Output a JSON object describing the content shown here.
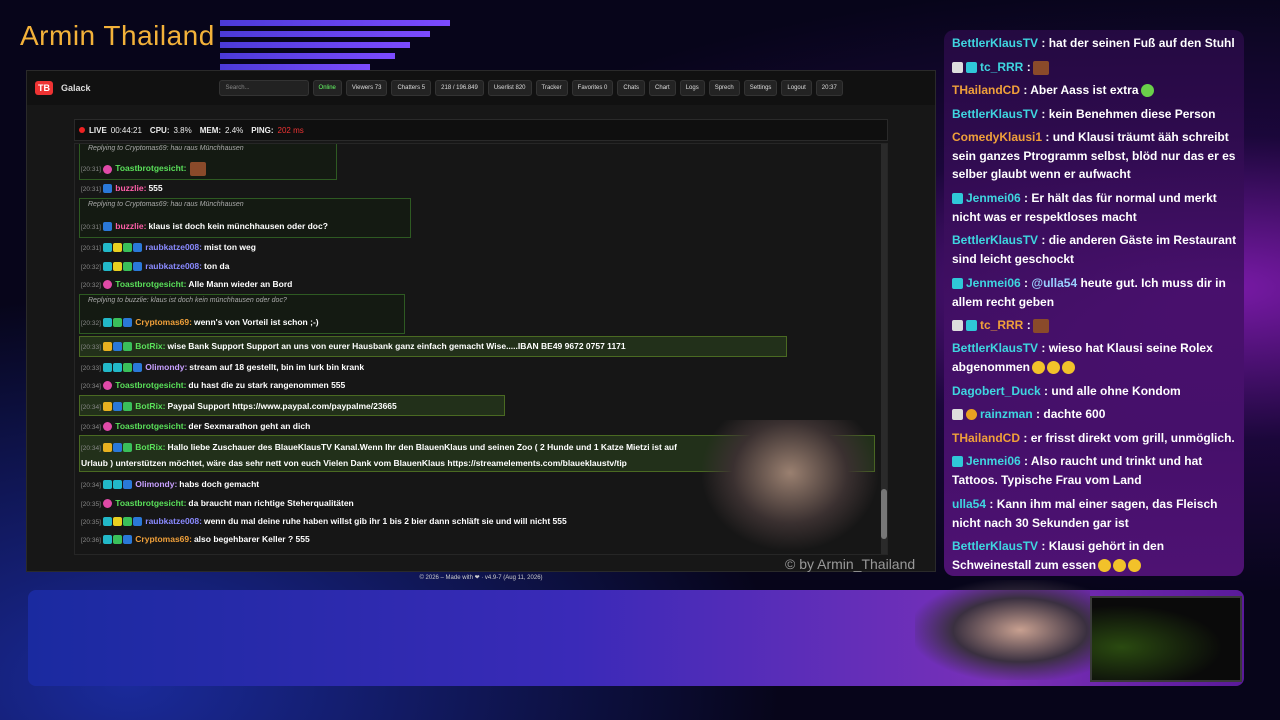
{
  "overlay": {
    "title": "Armin Thailand",
    "watermark": "© by Armin_Thailand"
  },
  "nav": {
    "logo": "TB",
    "brand": "Galack",
    "search_placeholder": "Search...",
    "online": "Online",
    "viewers": "Viewers 73",
    "chatters": "Chatters 5",
    "messages": "218 / 196.849",
    "userlist": "Userlist 820",
    "tracker": "Tracker",
    "favorites": "Favorites 0",
    "chats": "Chats",
    "chart": "Chart",
    "logs": "Logs",
    "sprech": "Sprech",
    "settings": "Settings",
    "logout": "Logout",
    "time": "20:37"
  },
  "status": {
    "live": "LIVE",
    "uptime": "00:44:21",
    "cpu_label": "CPU:",
    "cpu": "3.8%",
    "mem_label": "MEM:",
    "mem": "2.4%",
    "ping_label": "PING:",
    "ping": "202 ms"
  },
  "chat": {
    "r1": "Replying to Cryptomas69: hau raus Münchhausen",
    "m1": {
      "ts": "[20:31]",
      "user": "Toastbrotgesicht:",
      "text": ""
    },
    "m2": {
      "ts": "[20:31]",
      "user": "buzzlie:",
      "text": "555"
    },
    "r2": "Replying to Cryptomas69: hau raus Münchhausen",
    "m3": {
      "ts": "[20:31]",
      "user": "buzzlie:",
      "text": "klaus ist doch kein münchhausen oder doc?"
    },
    "m4": {
      "ts": "[20:31]",
      "user": "raubkatze008:",
      "text": "mist ton weg"
    },
    "m5": {
      "ts": "[20:32]",
      "user": "raubkatze008:",
      "text": "ton da"
    },
    "m6": {
      "ts": "[20:32]",
      "user": "Toastbrotgesicht:",
      "text": "Alle Mann wieder an Bord"
    },
    "r3": "Replying to buzzlie: klaus ist doch kein münchhausen oder doc?",
    "m7": {
      "ts": "[20:32]",
      "user": "Cryptomas69:",
      "text": "wenn's von Vorteil ist schon ;-)"
    },
    "m8": {
      "ts": "[20:33]",
      "user": "BotRix:",
      "text": "wise Bank Support Support an uns von eurer Hausbank ganz einfach gemacht Wise.....IBAN BE49 9672 0757 1171"
    },
    "m9": {
      "ts": "[20:33]",
      "user": "Olimondy:",
      "text": "stream auf 18 gestellt, bin im lurk bin krank"
    },
    "m10": {
      "ts": "[20:34]",
      "user": "Toastbrotgesicht:",
      "text": "du hast die zu stark rangenommen 555"
    },
    "m11": {
      "ts": "[20:34]",
      "user": "BotRix:",
      "text": "Paypal Support https://www.paypal.com/paypalme/23665"
    },
    "m12": {
      "ts": "[20:34]",
      "user": "Toastbrotgesicht:",
      "text": "der Sexmarathon geht an dich"
    },
    "m13": {
      "ts": "[20:34]",
      "user": "BotRix:",
      "text": "Hallo liebe Zuschauer des BlaueKlausTV Kanal.Wenn Ihr den BlauenKlaus und seinen Zoo ( 2 Hunde und 1 Katze Mietzi ist auf",
      "text2": "Urlaub ) unterstützen möchtet, wäre das sehr nett von euch Vielen Dank vom BlauenKlaus https://streamelements.com/blaueklaustv/tip"
    },
    "m14": {
      "ts": "[20:34]",
      "user": "Olimondy:",
      "text": "habs doch gemacht"
    },
    "m15": {
      "ts": "[20:35]",
      "user": "Toastbrotgesicht:",
      "text": "da braucht man richtige Steherqualitäten"
    },
    "m16": {
      "ts": "[20:35]",
      "user": "raubkatze008:",
      "text": "wenn du mal deine ruhe haben willst gib ihr 1 bis 2 bier dann schläft sie und will nicht 555"
    },
    "m17": {
      "ts": "[20:36]",
      "user": "Cryptomas69:",
      "text": "also begehbarer Keller ? 555"
    }
  },
  "footer": "© 2026 – Made with ❤ · v4.9-7 (Aug 11, 2026)",
  "side_chat": [
    {
      "user": "BettlerKlausTV",
      "text": ": hat der seinen Fuß auf den Stuhl"
    },
    {
      "user": "tc_RRR",
      "text": ":"
    },
    {
      "user": "THailandCD",
      "text": ": Aber Aass ist extra"
    },
    {
      "user": "BettlerKlausTV",
      "text": ": kein Benehmen diese Person"
    },
    {
      "user": "ComedyKlausi1",
      "text": ": und Klausi träumt ääh schreibt sein ganzes Ptrogramm selbst, blöd nur das er es selber glaubt wenn er aufwacht"
    },
    {
      "user": "Jenmei06",
      "text": ": Er hält das für normal und merkt nicht was er respektloses macht"
    },
    {
      "user": "BettlerKlausTV",
      "text": ": die anderen Gäste im Restaurant sind leicht geschockt"
    },
    {
      "user": "Jenmei06",
      "text": ":",
      "mention": "@ulla54",
      "text2": "heute gut. Ich muss dir in allem recht geben"
    },
    {
      "user": "tc_RRR",
      "text": ":"
    },
    {
      "user": "BettlerKlausTV",
      "text": ": wieso hat Klausi seine Rolex abgenommen"
    },
    {
      "user": "Dagobert_Duck",
      "text": ": und alle ohne Kondom"
    },
    {
      "user": "rainzman",
      "text": ": dachte 600"
    },
    {
      "user": "THailandCD",
      "text": ": er frisst direkt vom grill, unmöglich."
    },
    {
      "user": "Jenmei06",
      "text": ": Also raucht und trinkt und hat Tattoos. Typische Frau vom Land"
    },
    {
      "user": "ulla54",
      "text": ": Kann ihm mal einer sagen, das Fleisch nicht nach 30 Sekunden gar ist"
    },
    {
      "user": "BettlerKlausTV",
      "text": ": Klausi gehört in den Schweinestall zum essen"
    }
  ],
  "colors": {
    "gold": "#f3b23a",
    "cyan": "#3fd6e0",
    "green": "#5ae05a",
    "pink": "#ff5fa8",
    "purple": "#8a8aff",
    "orange": "#f0a03a"
  }
}
